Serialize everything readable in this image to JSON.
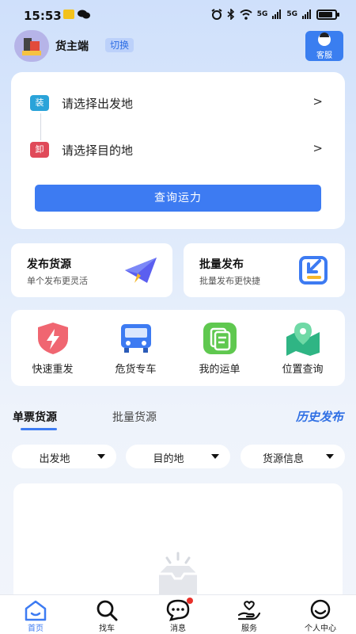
{
  "status_bar": {
    "time": "15:53",
    "signal1": "5G",
    "signal2": "5G"
  },
  "header": {
    "role_name": "货主端",
    "switch_label": "切换",
    "service_label": "客服"
  },
  "route": {
    "origin_tag": "装",
    "origin_placeholder": "请选择出发地",
    "dest_tag": "卸",
    "dest_placeholder": "请选择目的地",
    "arrow": ">",
    "query_button": "查询运力"
  },
  "publish": [
    {
      "title": "发布货源",
      "subtitle": "单个发布更灵活"
    },
    {
      "title": "批量发布",
      "subtitle": "批量发布更快捷"
    }
  ],
  "quick_actions": [
    {
      "label": "快速重发",
      "icon": "shield-bolt-icon"
    },
    {
      "label": "危货专车",
      "icon": "truck-icon"
    },
    {
      "label": "我的运单",
      "icon": "waybill-icon"
    },
    {
      "label": "位置查询",
      "icon": "map-pin-icon"
    }
  ],
  "tabs": {
    "active": "单票货源",
    "inactive": "批量货源",
    "history_link": "历史发布"
  },
  "filters": [
    "出发地",
    "目的地",
    "货源信息"
  ],
  "bottom_nav": [
    {
      "label": "首页",
      "icon": "home-icon",
      "active": true
    },
    {
      "label": "找车",
      "icon": "search-icon",
      "active": false
    },
    {
      "label": "消息",
      "icon": "message-icon",
      "active": false,
      "badge": true
    },
    {
      "label": "服务",
      "icon": "service-hand-icon",
      "active": false
    },
    {
      "label": "个人中心",
      "icon": "profile-icon",
      "active": false
    }
  ],
  "colors": {
    "primary": "#3d7bf2",
    "origin_tag": "#2aa3d9",
    "dest_tag": "#e04a59",
    "badge": "#e8302a"
  }
}
